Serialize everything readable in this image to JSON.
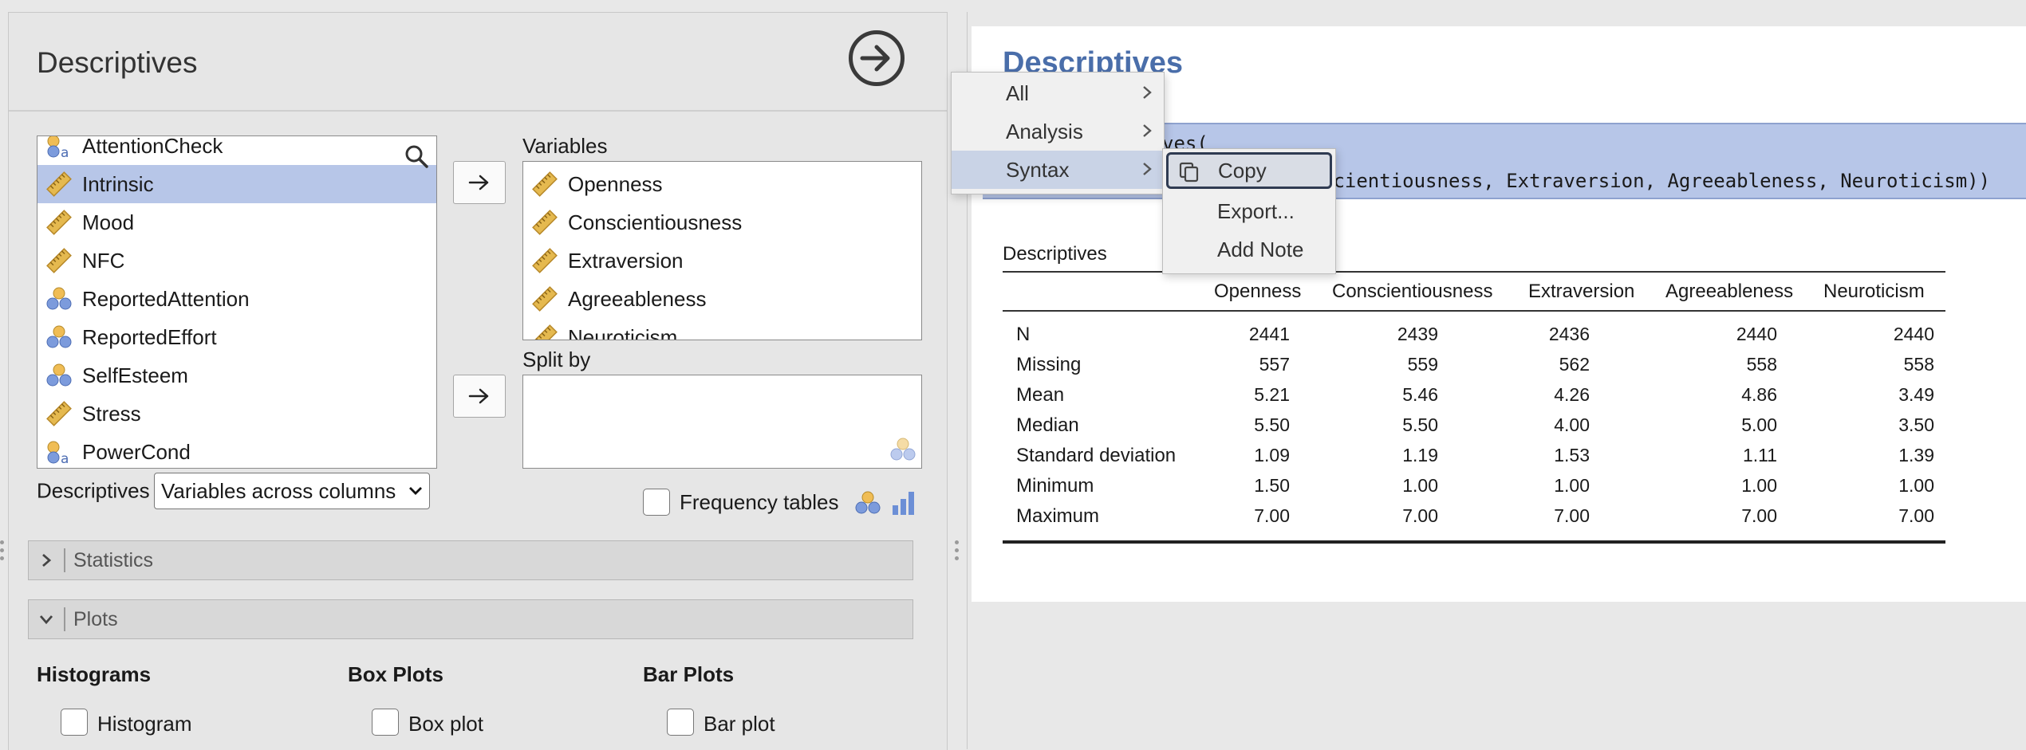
{
  "options": {
    "title": "Descriptives",
    "source_variables": [
      {
        "label": "AttentionCheck",
        "icon": "nominal-text-icon"
      },
      {
        "label": "Intrinsic",
        "icon": "continuous-ruler-icon",
        "selected": true
      },
      {
        "label": "Mood",
        "icon": "continuous-ruler-icon"
      },
      {
        "label": "NFC",
        "icon": "continuous-ruler-icon"
      },
      {
        "label": "ReportedAttention",
        "icon": "nominal-circles-icon"
      },
      {
        "label": "ReportedEffort",
        "icon": "nominal-circles-icon"
      },
      {
        "label": "SelfEsteem",
        "icon": "nominal-circles-icon"
      },
      {
        "label": "Stress",
        "icon": "continuous-ruler-icon"
      },
      {
        "label": "PowerCond",
        "icon": "nominal-text-icon"
      }
    ],
    "variables_label": "Variables",
    "target_variables": [
      "Openness",
      "Conscientiousness",
      "Extraversion",
      "Agreeableness",
      "Neuroticism"
    ],
    "split_by_label": "Split by",
    "descriptives_label": "Descriptives",
    "descriptives_select_value": "Variables across columns",
    "frequency_tables_label": "Frequency tables",
    "statistics_section": "Statistics",
    "plots_section": "Plots",
    "histograms_label": "Histograms",
    "histogram_label": "Histogram",
    "box_plots_label": "Box Plots",
    "box_plot_label": "Box plot",
    "bar_plots_label": "Bar Plots",
    "bar_plot_label": "Bar plot"
  },
  "results": {
    "title": "Descriptives",
    "syntax_line1": "ves(",
    "syntax_line2": "scientiousness, Extraversion, Agreeableness, Neuroticism))",
    "table_title": "Descriptives",
    "columns": [
      "Openness",
      "Conscientiousness",
      "Extraversion",
      "Agreeableness",
      "Neuroticism"
    ],
    "rows": [
      {
        "label": "N",
        "values": [
          "2441",
          "2439",
          "2436",
          "2440",
          "2440"
        ]
      },
      {
        "label": "Missing",
        "values": [
          "557",
          "559",
          "562",
          "558",
          "558"
        ]
      },
      {
        "label": "Mean",
        "values": [
          "5.21",
          "5.46",
          "4.26",
          "4.86",
          "3.49"
        ]
      },
      {
        "label": "Median",
        "values": [
          "5.50",
          "5.50",
          "4.00",
          "5.00",
          "3.50"
        ]
      },
      {
        "label": "Standard deviation",
        "values": [
          "1.09",
          "1.19",
          "1.53",
          "1.11",
          "1.39"
        ]
      },
      {
        "label": "Minimum",
        "values": [
          "1.50",
          "1.00",
          "1.00",
          "1.00",
          "1.00"
        ]
      },
      {
        "label": "Maximum",
        "values": [
          "7.00",
          "7.00",
          "7.00",
          "7.00",
          "7.00"
        ]
      }
    ]
  },
  "context_menu": {
    "items": [
      "All",
      "Analysis",
      "Syntax"
    ],
    "active": "Syntax",
    "submenu": [
      "Copy",
      "Export...",
      "Add Note"
    ]
  },
  "colors": {
    "selection": "#b7c6e8",
    "results_title": "#4a6eaa",
    "ruler_icon": "#e5b94f",
    "nominal_icon_blue": "#7c9bdc",
    "nominal_icon_orange": "#f0bd55"
  }
}
